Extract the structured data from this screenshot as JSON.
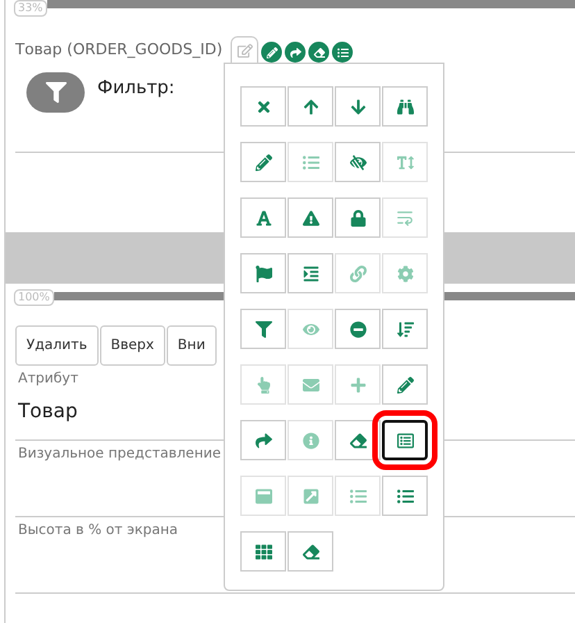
{
  "top_progress": {
    "label": "33%",
    "level": 1
  },
  "field": {
    "label": "Товар (ORDER_GOODS_ID)",
    "actions": [
      {
        "kind": "pencil"
      },
      {
        "kind": "share"
      },
      {
        "kind": "eraser"
      },
      {
        "kind": "list"
      }
    ]
  },
  "filter": {
    "label": "Фильтр:"
  },
  "second_progress": {
    "label": "100%",
    "level": 1
  },
  "buttons": [
    "Удалить",
    "Вверх",
    "Вни"
  ],
  "form": [
    {
      "label": "Атрибут",
      "value": "Товар"
    },
    {
      "label": "Визуальное представление"
    },
    {
      "label": "Высота в % от экрана"
    }
  ],
  "tool_popup": {
    "rows": [
      [
        {
          "kind": "close",
          "disabled": false,
          "selected": false
        },
        {
          "kind": "arrow-up",
          "disabled": false,
          "selected": false
        },
        {
          "kind": "arrow-down",
          "disabled": false,
          "selected": false
        },
        {
          "kind": "binoculars",
          "disabled": false,
          "selected": false
        }
      ],
      [
        {
          "kind": "pencil",
          "disabled": false,
          "selected": false
        },
        {
          "kind": "list",
          "disabled": true,
          "selected": false
        },
        {
          "kind": "eye-slash",
          "disabled": false,
          "selected": false
        },
        {
          "kind": "text-height",
          "disabled": true,
          "selected": false
        }
      ],
      [
        {
          "kind": "font",
          "disabled": false,
          "selected": false
        },
        {
          "kind": "warning",
          "disabled": false,
          "selected": false
        },
        {
          "kind": "lock",
          "disabled": false,
          "selected": false
        },
        {
          "kind": "wrap",
          "disabled": true,
          "selected": false
        }
      ],
      [
        {
          "kind": "flag",
          "disabled": false,
          "selected": false
        },
        {
          "kind": "indent",
          "disabled": false,
          "selected": false
        },
        {
          "kind": "link",
          "disabled": true,
          "selected": false
        },
        {
          "kind": "gear",
          "disabled": true,
          "selected": false
        }
      ],
      [
        {
          "kind": "filter",
          "disabled": false,
          "selected": false
        },
        {
          "kind": "eye",
          "disabled": true,
          "selected": false
        },
        {
          "kind": "minus",
          "disabled": false,
          "selected": false
        },
        {
          "kind": "sort",
          "disabled": false,
          "selected": false
        }
      ],
      [
        {
          "kind": "hand",
          "disabled": true,
          "selected": false
        },
        {
          "kind": "envelope",
          "disabled": true,
          "selected": false
        },
        {
          "kind": "plus",
          "disabled": true,
          "selected": false
        },
        {
          "kind": "pencil",
          "disabled": false,
          "selected": false
        }
      ],
      [
        {
          "kind": "share",
          "disabled": false,
          "selected": false
        },
        {
          "kind": "info",
          "disabled": true,
          "selected": false
        },
        {
          "kind": "eraser",
          "disabled": false,
          "selected": false
        },
        {
          "kind": "list-alt",
          "disabled": false,
          "selected": true
        }
      ],
      [
        {
          "kind": "window",
          "disabled": true,
          "selected": false
        },
        {
          "kind": "external",
          "disabled": true,
          "selected": false
        },
        {
          "kind": "list",
          "disabled": true,
          "selected": false
        },
        {
          "kind": "list",
          "disabled": false,
          "selected": false
        }
      ],
      [
        {
          "kind": "grid",
          "disabled": false,
          "selected": false
        },
        {
          "kind": "eraser",
          "disabled": false,
          "selected": false
        }
      ]
    ]
  }
}
